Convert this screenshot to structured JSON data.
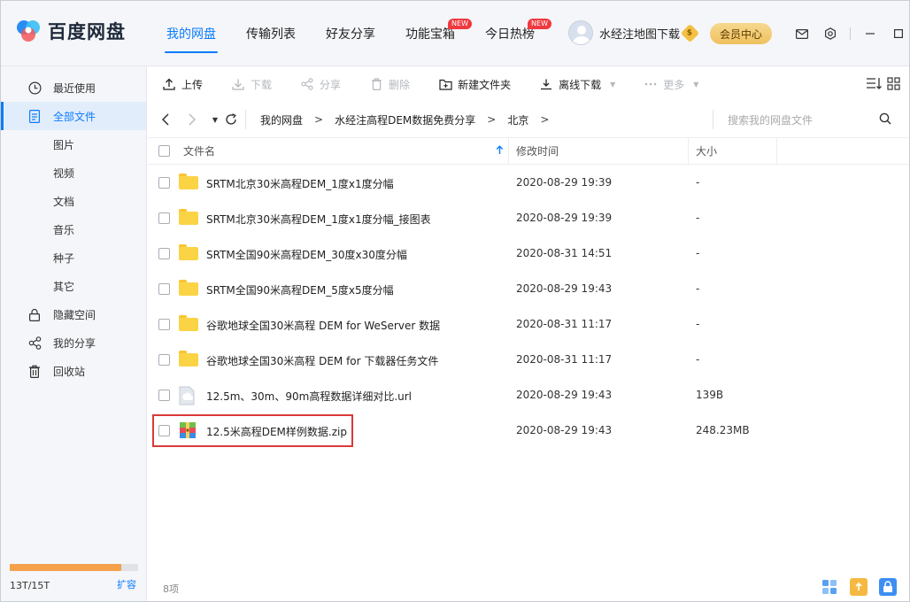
{
  "app": {
    "name": "百度网盘"
  },
  "nav": {
    "tabs": [
      {
        "label": "我的网盘",
        "active": true
      },
      {
        "label": "传输列表"
      },
      {
        "label": "好友分享"
      },
      {
        "label": "功能宝箱",
        "badge": "NEW"
      },
      {
        "label": "今日热榜",
        "badge": "NEW"
      }
    ]
  },
  "user": {
    "name": "水经注地图下载",
    "vip_label": "会员中心",
    "coin_symbol": "$"
  },
  "sidebar": {
    "items": [
      {
        "label": "最近使用",
        "icon": "clock-icon"
      },
      {
        "label": "全部文件",
        "icon": "document-icon",
        "active": true
      },
      {
        "label": "图片"
      },
      {
        "label": "视频"
      },
      {
        "label": "文档"
      },
      {
        "label": "音乐"
      },
      {
        "label": "种子"
      },
      {
        "label": "其它"
      },
      {
        "label": "隐藏空间",
        "icon": "lock-icon"
      },
      {
        "label": "我的分享",
        "icon": "share-icon"
      },
      {
        "label": "回收站",
        "icon": "trash-icon"
      }
    ],
    "storage_text": "13T/15T",
    "storage_fraction": 0.8667,
    "expand_label": "扩容"
  },
  "toolbar": {
    "upload": "上传",
    "download": "下载",
    "share": "分享",
    "delete": "删除",
    "new_folder": "新建文件夹",
    "offline_download": "离线下载",
    "more": "更多"
  },
  "breadcrumb": {
    "items": [
      "我的网盘",
      "水经注高程DEM数据免费分享",
      "北京"
    ],
    "sep": ">"
  },
  "search": {
    "placeholder": "搜索我的网盘文件"
  },
  "table": {
    "headers": {
      "name": "文件名",
      "time": "修改时间",
      "size": "大小"
    },
    "rows": [
      {
        "name": "SRTM北京30米高程DEM_1度x1度分幅",
        "time": "2020-08-29 19:39",
        "size": "-",
        "type": "folder"
      },
      {
        "name": "SRTM北京30米高程DEM_1度x1度分幅_接图表",
        "time": "2020-08-29 19:39",
        "size": "-",
        "type": "folder"
      },
      {
        "name": "SRTM全国90米高程DEM_30度x30度分幅",
        "time": "2020-08-31 14:51",
        "size": "-",
        "type": "folder"
      },
      {
        "name": "SRTM全国90米高程DEM_5度x5度分幅",
        "time": "2020-08-29 19:43",
        "size": "-",
        "type": "folder"
      },
      {
        "name": "谷歌地球全国30米高程 DEM for WeServer 数据",
        "time": "2020-08-31 11:17",
        "size": "-",
        "type": "folder"
      },
      {
        "name": "谷歌地球全国30米高程 DEM for 下载器任务文件",
        "time": "2020-08-31 11:17",
        "size": "-",
        "type": "folder"
      },
      {
        "name": "12.5m、30m、90m高程数据详细对比.url",
        "time": "2020-08-29 19:43",
        "size": "139B",
        "type": "url"
      },
      {
        "name": "12.5米高程DEM样例数据.zip",
        "time": "2020-08-29 19:43",
        "size": "248.23MB",
        "type": "zip",
        "highlighted": true
      }
    ]
  },
  "status": {
    "count": "8项"
  },
  "colors": {
    "accent": "#0b7cff",
    "highlight": "#d93a3a",
    "storage": "#f5a14c"
  }
}
